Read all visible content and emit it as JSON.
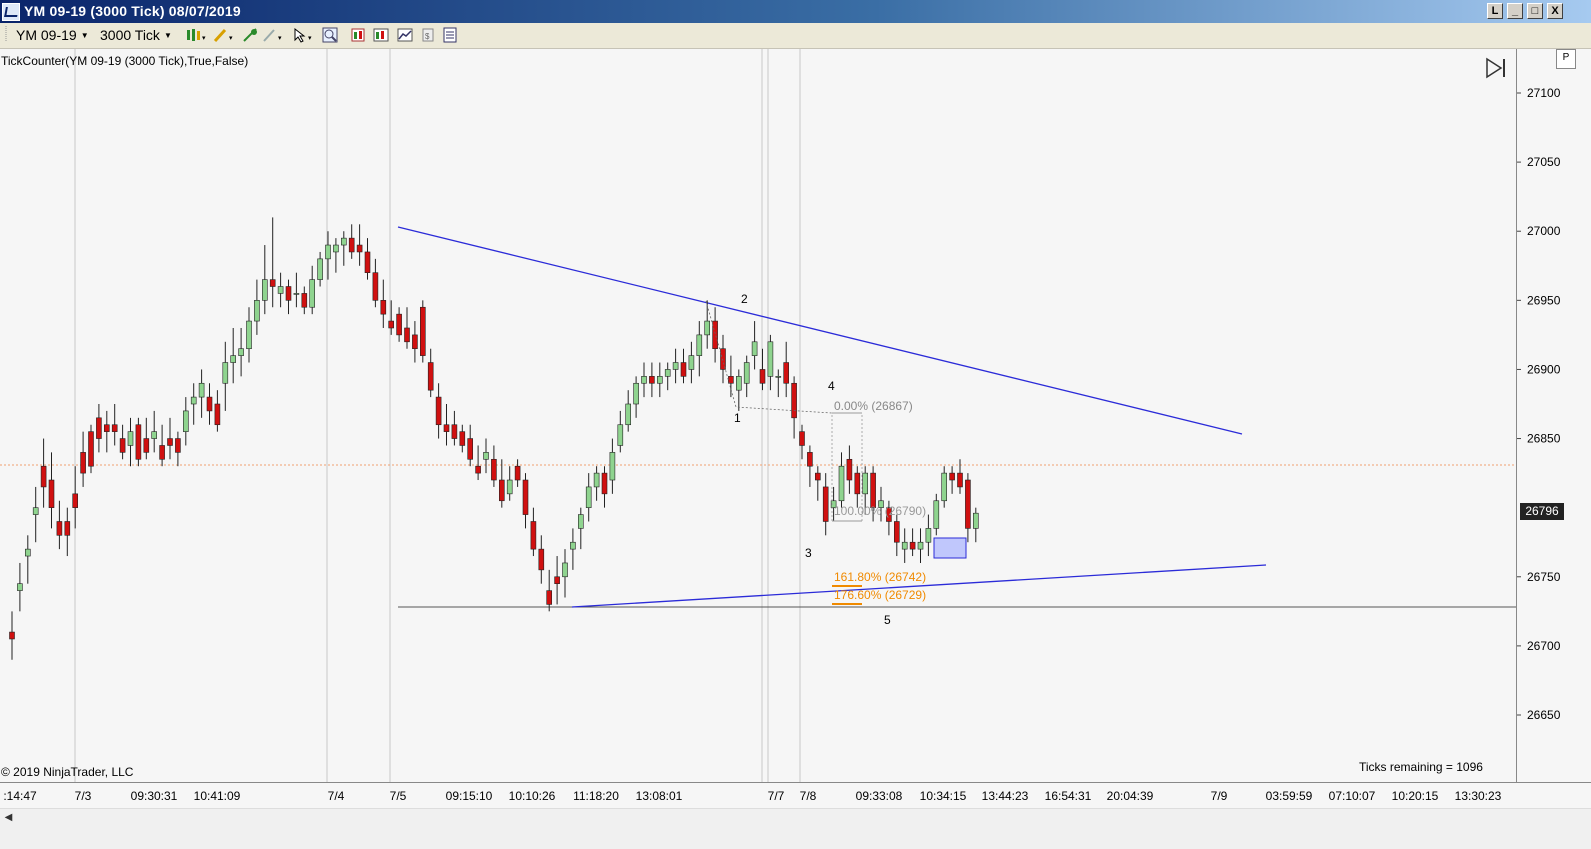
{
  "window": {
    "title": "YM 09-19 (3000 Tick)  08/07/2019",
    "buttons": [
      "L",
      "_",
      "□",
      "X"
    ]
  },
  "toolbar": {
    "instrument": "YM 09-19",
    "interval": "3000 Tick"
  },
  "chart": {
    "indicator_label": "TickCounter(YM 09-19 (3000 Tick),True,False)",
    "copyright": "© 2019 NinjaTrader, LLC",
    "ticks_remaining": "Ticks remaining = 1096",
    "last_price": "26796",
    "price_axis_labels": [
      "27100",
      "27050",
      "27000",
      "26950",
      "26900",
      "26850",
      "26750",
      "26700",
      "26650"
    ],
    "time_axis_labels": [
      ":14:47",
      "7/3",
      "09:30:31",
      "10:41:09",
      "7/4",
      "7/5",
      "09:15:10",
      "10:10:26",
      "11:18:20",
      "13:08:01",
      "7/7",
      "7/8",
      "09:33:08",
      "10:34:15",
      "13:44:23",
      "16:54:31",
      "20:04:39",
      "7/9",
      "03:59:59",
      "07:10:07",
      "10:20:15",
      "13:30:23"
    ],
    "wave_labels": [
      "1",
      "2",
      "3",
      "4",
      "5"
    ],
    "fib_labels": {
      "zero": "0.00% (26867)",
      "hundred": "100.00% (26790)",
      "ext_161": "161.80% (26742)",
      "ext_176": "176.60% (26729)"
    },
    "colors": {
      "up_candle": "#8fd48f",
      "down_candle": "#d01010",
      "trendline": "#2b2bd8",
      "fib_extension": "#f08a00",
      "fib_retrace": "#999999",
      "current_price_line": "#f0a070"
    }
  },
  "chart_data": {
    "type": "candlestick",
    "instrument": "YM 09-19",
    "interval": "3000 Tick",
    "ylim": [
      26625,
      27125
    ],
    "last_price": 26796,
    "candles": [
      [
        26710,
        26725,
        26690,
        26705
      ],
      [
        26740,
        26760,
        26725,
        26745
      ],
      [
        26765,
        26780,
        26745,
        26770
      ],
      [
        26795,
        26815,
        26775,
        26800
      ],
      [
        26830,
        26850,
        26800,
        26815
      ],
      [
        26820,
        26840,
        26785,
        26800
      ],
      [
        26790,
        26805,
        26770,
        26780
      ],
      [
        26790,
        26800,
        26765,
        26780
      ],
      [
        26810,
        26830,
        26785,
        26800
      ],
      [
        26840,
        26855,
        26815,
        26825
      ],
      [
        26855,
        26860,
        26825,
        26830
      ],
      [
        26865,
        26875,
        26840,
        26850
      ],
      [
        26860,
        26870,
        26840,
        26855
      ],
      [
        26860,
        26875,
        26845,
        26855
      ],
      [
        26850,
        26860,
        26835,
        26840
      ],
      [
        26845,
        26865,
        26830,
        26855
      ],
      [
        26860,
        26865,
        26830,
        26835
      ],
      [
        26850,
        26865,
        26835,
        26840
      ],
      [
        26850,
        26870,
        26840,
        26855
      ],
      [
        26845,
        26860,
        26830,
        26835
      ],
      [
        26850,
        26865,
        26835,
        26845
      ],
      [
        26850,
        26855,
        26830,
        26840
      ],
      [
        26855,
        26880,
        26845,
        26870
      ],
      [
        26875,
        26890,
        26860,
        26880
      ],
      [
        26880,
        26900,
        26865,
        26890
      ],
      [
        26880,
        26890,
        26860,
        26870
      ],
      [
        26875,
        26885,
        26855,
        26860
      ],
      [
        26890,
        26920,
        26870,
        26905
      ],
      [
        26905,
        26930,
        26890,
        26910
      ],
      [
        26910,
        26930,
        26895,
        26915
      ],
      [
        26915,
        26945,
        26905,
        26935
      ],
      [
        26935,
        26965,
        26925,
        26950
      ],
      [
        26950,
        26990,
        26940,
        26965
      ],
      [
        26965,
        27010,
        26945,
        26960
      ],
      [
        26955,
        26970,
        26945,
        26960
      ],
      [
        26960,
        26965,
        26940,
        26950
      ],
      [
        26955,
        26970,
        26945,
        26955
      ],
      [
        26955,
        26960,
        26940,
        26945
      ],
      [
        26945,
        26975,
        26940,
        26965
      ],
      [
        26965,
        26985,
        26960,
        26980
      ],
      [
        26980,
        27000,
        26965,
        26990
      ],
      [
        26985,
        26995,
        26970,
        26990
      ],
      [
        26990,
        27000,
        26975,
        26995
      ],
      [
        26995,
        27005,
        26980,
        26985
      ],
      [
        26990,
        27005,
        26975,
        26985
      ],
      [
        26985,
        26995,
        26965,
        26970
      ],
      [
        26970,
        26980,
        26945,
        26950
      ],
      [
        26950,
        26965,
        26930,
        26940
      ],
      [
        26935,
        26950,
        26925,
        26930
      ],
      [
        26940,
        26945,
        26920,
        26925
      ],
      [
        26930,
        26945,
        26915,
        26920
      ],
      [
        26925,
        26935,
        26905,
        26915
      ],
      [
        26945,
        26950,
        26905,
        26910
      ],
      [
        26905,
        26915,
        26880,
        26885
      ],
      [
        26880,
        26890,
        26850,
        26860
      ],
      [
        26860,
        26875,
        26845,
        26855
      ],
      [
        26860,
        26870,
        26845,
        26850
      ],
      [
        26855,
        26860,
        26840,
        26845
      ],
      [
        26850,
        26860,
        26830,
        26835
      ],
      [
        26830,
        26845,
        26820,
        26825
      ],
      [
        26835,
        26850,
        26825,
        26840
      ],
      [
        26835,
        26845,
        26815,
        26820
      ],
      [
        26820,
        26835,
        26800,
        26805
      ],
      [
        26810,
        26830,
        26805,
        26820
      ],
      [
        26830,
        26835,
        26815,
        26820
      ],
      [
        26820,
        26825,
        26785,
        26795
      ],
      [
        26790,
        26800,
        26765,
        26770
      ],
      [
        26770,
        26780,
        26745,
        26755
      ],
      [
        26740,
        26755,
        26725,
        26730
      ],
      [
        26750,
        26765,
        26730,
        26745
      ],
      [
        26750,
        26770,
        26735,
        26760
      ],
      [
        26770,
        26785,
        26755,
        26775
      ],
      [
        26785,
        26800,
        26770,
        26795
      ],
      [
        26800,
        26825,
        26790,
        26815
      ],
      [
        26815,
        26830,
        26805,
        26825
      ],
      [
        26825,
        26830,
        26800,
        26810
      ],
      [
        26820,
        26850,
        26810,
        26840
      ],
      [
        26845,
        26870,
        26840,
        26860
      ],
      [
        26860,
        26885,
        26855,
        26875
      ],
      [
        26875,
        26895,
        26865,
        26890
      ],
      [
        26890,
        26905,
        26880,
        26895
      ],
      [
        26895,
        26905,
        26880,
        26890
      ],
      [
        26890,
        26905,
        26880,
        26895
      ],
      [
        26895,
        26905,
        26885,
        26900
      ],
      [
        26900,
        26915,
        26890,
        26905
      ],
      [
        26905,
        26915,
        26890,
        26895
      ],
      [
        26900,
        26920,
        26890,
        26910
      ],
      [
        26910,
        26935,
        26895,
        26925
      ],
      [
        26925,
        26950,
        26915,
        26935
      ],
      [
        26935,
        26945,
        26905,
        26915
      ],
      [
        26915,
        26925,
        26890,
        26900
      ],
      [
        26895,
        26910,
        26880,
        26890
      ],
      [
        26885,
        26900,
        26870,
        26895
      ],
      [
        26890,
        26910,
        26880,
        26905
      ],
      [
        26910,
        26935,
        26900,
        26920
      ],
      [
        26900,
        26915,
        26885,
        26890
      ],
      [
        26895,
        26925,
        26885,
        26920
      ],
      [
        26895,
        26900,
        26880,
        26895
      ],
      [
        26905,
        26920,
        26880,
        26890
      ],
      [
        26890,
        26895,
        26850,
        26865
      ],
      [
        26855,
        26860,
        26835,
        26845
      ],
      [
        26840,
        26845,
        26815,
        26830
      ],
      [
        26825,
        26830,
        26805,
        26820
      ],
      [
        26815,
        26825,
        26780,
        26790
      ],
      [
        26800,
        26815,
        26790,
        26805
      ],
      [
        26805,
        26840,
        26800,
        26830
      ],
      [
        26835,
        26845,
        26810,
        26820
      ],
      [
        26825,
        26830,
        26800,
        26810
      ],
      [
        26810,
        26830,
        26795,
        26825
      ],
      [
        26825,
        26830,
        26790,
        26800
      ],
      [
        26800,
        26815,
        26790,
        26805
      ],
      [
        26800,
        26805,
        26780,
        26790
      ],
      [
        26790,
        26795,
        26765,
        26775
      ],
      [
        26770,
        26785,
        26760,
        26775
      ],
      [
        26775,
        26785,
        26765,
        26770
      ],
      [
        26770,
        26785,
        26760,
        26775
      ],
      [
        26775,
        26795,
        26765,
        26785
      ],
      [
        26785,
        26810,
        26780,
        26805
      ],
      [
        26805,
        26830,
        26800,
        26825
      ],
      [
        26825,
        26830,
        26810,
        26820
      ],
      [
        26825,
        26835,
        26810,
        26815
      ],
      [
        26820,
        26825,
        26775,
        26785
      ],
      [
        26785,
        26800,
        26775,
        26796
      ]
    ],
    "trendlines": [
      {
        "from": [
          "7/5",
          27005
        ],
        "to": [
          "7/9",
          26855
        ]
      },
      {
        "from": [
          "7/5",
          26727
        ],
        "to": [
          "7/9",
          26758
        ]
      }
    ],
    "horizontal_lines": [
      26727,
      26830
    ],
    "fibonacci": {
      "0%": 26867,
      "100%": 26790,
      "161.8%": 26742,
      "176.6%": 26729
    },
    "wave_labels": [
      "1",
      "2",
      "3",
      "4",
      "5"
    ]
  }
}
